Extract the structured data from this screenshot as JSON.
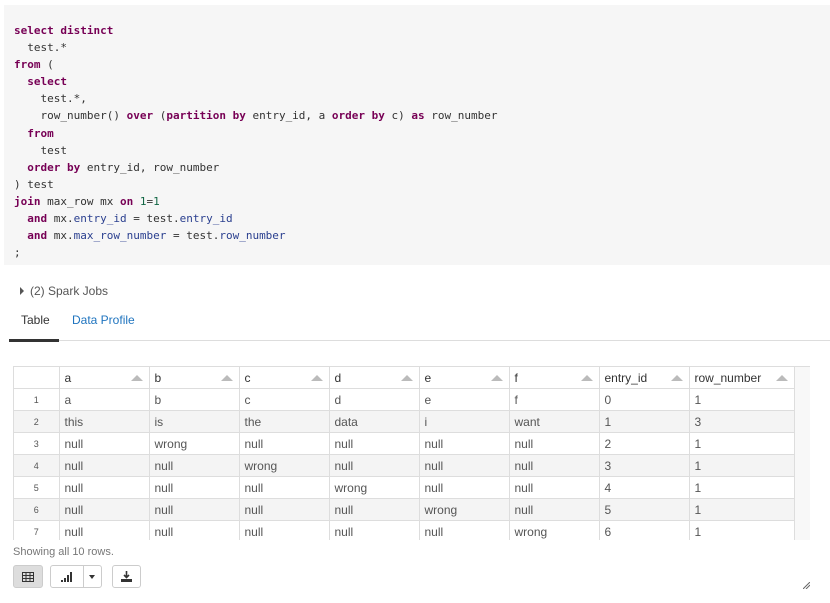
{
  "code": {
    "lines": [
      [
        {
          "t": "kw",
          "v": "select distinct"
        }
      ],
      [
        {
          "t": "id",
          "v": "  test.*"
        }
      ],
      [
        {
          "t": "kw",
          "v": "from"
        },
        {
          "t": "id",
          "v": " ("
        }
      ],
      [
        {
          "t": "kw",
          "v": "  select"
        }
      ],
      [
        {
          "t": "id",
          "v": "    test.*,"
        }
      ],
      [
        {
          "t": "id",
          "v": "    row_number() "
        },
        {
          "t": "kw",
          "v": "over"
        },
        {
          "t": "id",
          "v": " ("
        },
        {
          "t": "kw",
          "v": "partition by"
        },
        {
          "t": "id",
          "v": " entry_id, a "
        },
        {
          "t": "kw",
          "v": "order by"
        },
        {
          "t": "id",
          "v": " c) "
        },
        {
          "t": "kw",
          "v": "as"
        },
        {
          "t": "id",
          "v": " row_number"
        }
      ],
      [
        {
          "t": "kw",
          "v": "  from"
        }
      ],
      [
        {
          "t": "id",
          "v": "    test"
        }
      ],
      [
        {
          "t": "kw",
          "v": "  order by"
        },
        {
          "t": "id",
          "v": " entry_id, row_number"
        }
      ],
      [
        {
          "t": "id",
          "v": ") test"
        }
      ],
      [
        {
          "t": "kw",
          "v": "join"
        },
        {
          "t": "id",
          "v": " max_row mx "
        },
        {
          "t": "kw",
          "v": "on"
        },
        {
          "t": "num",
          "v": " 1"
        },
        {
          "t": "id",
          "v": "="
        },
        {
          "t": "num",
          "v": "1"
        }
      ],
      [
        {
          "t": "kw",
          "v": "  and"
        },
        {
          "t": "id",
          "v": " mx."
        },
        {
          "t": "prop",
          "v": "entry_id"
        },
        {
          "t": "id",
          "v": " = test."
        },
        {
          "t": "prop",
          "v": "entry_id"
        }
      ],
      [
        {
          "t": "kw",
          "v": "  and"
        },
        {
          "t": "id",
          "v": " mx."
        },
        {
          "t": "prop",
          "v": "max_row_number"
        },
        {
          "t": "id",
          "v": " = test."
        },
        {
          "t": "prop",
          "v": "row_number"
        }
      ],
      [
        {
          "t": "id",
          "v": ";"
        }
      ]
    ]
  },
  "spark_jobs": {
    "label": "(2) Spark Jobs"
  },
  "tabs": {
    "table": "Table",
    "data_profile": "Data Profile"
  },
  "grid": {
    "columns": [
      "a",
      "b",
      "c",
      "d",
      "e",
      "f",
      "entry_id",
      "row_number"
    ],
    "rows": [
      {
        "index": "1",
        "cells": [
          "a",
          "b",
          "c",
          "d",
          "e",
          "f",
          "0",
          "1"
        ]
      },
      {
        "index": "2",
        "cells": [
          "this",
          "is",
          "the",
          "data",
          "i",
          "want",
          "1",
          "3"
        ]
      },
      {
        "index": "3",
        "cells": [
          "null",
          "wrong",
          "null",
          "null",
          "null",
          "null",
          "2",
          "1"
        ]
      },
      {
        "index": "4",
        "cells": [
          "null",
          "null",
          "wrong",
          "null",
          "null",
          "null",
          "3",
          "1"
        ]
      },
      {
        "index": "5",
        "cells": [
          "null",
          "null",
          "null",
          "wrong",
          "null",
          "null",
          "4",
          "1"
        ]
      },
      {
        "index": "6",
        "cells": [
          "null",
          "null",
          "null",
          "null",
          "wrong",
          "null",
          "5",
          "1"
        ]
      },
      {
        "index": "7",
        "cells": [
          "null",
          "null",
          "null",
          "null",
          "null",
          "wrong",
          "6",
          "1"
        ]
      }
    ]
  },
  "status": {
    "text": "Showing all 10 rows."
  },
  "toolbar": {
    "table_icon": "table-icon",
    "chart_icon": "bar-chart-icon",
    "dropdown_icon": "caret-down-icon",
    "download_icon": "download-icon"
  }
}
